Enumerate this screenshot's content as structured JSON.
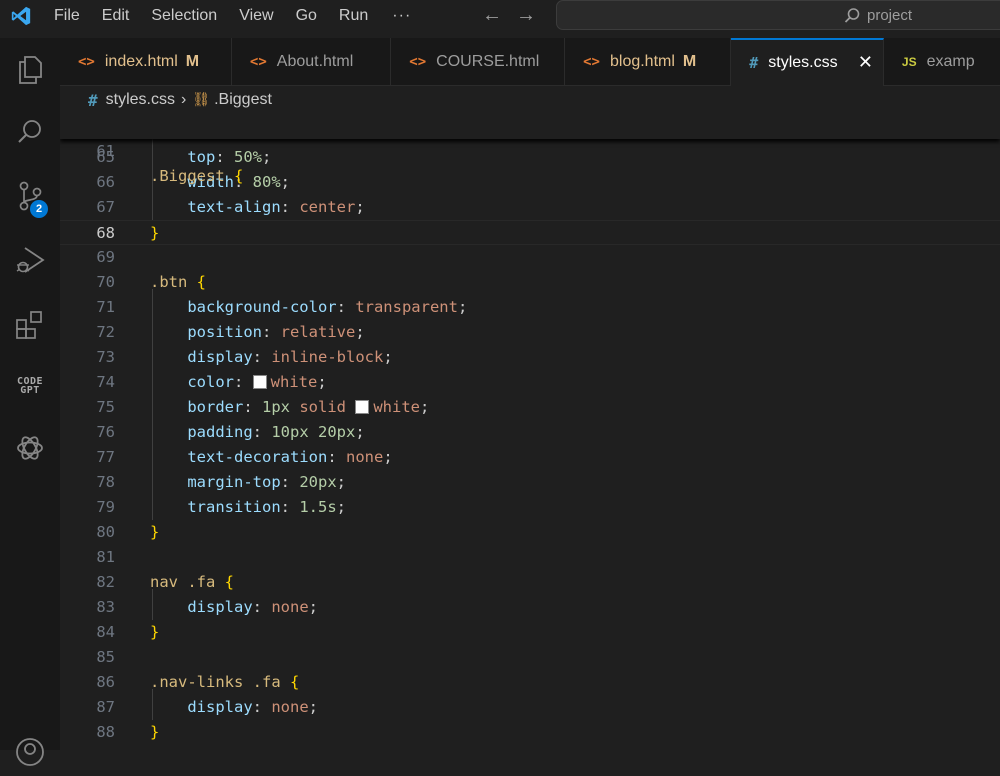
{
  "titlebar": {
    "menu": [
      "File",
      "Edit",
      "Selection",
      "View",
      "Go",
      "Run",
      "···"
    ],
    "search_text": "project"
  },
  "activity": {
    "scm_badge": "2",
    "codegpt_line1": "CODE",
    "codegpt_line2": "GPT"
  },
  "tabs": [
    {
      "name": "index.html",
      "type": "html",
      "modified": "M"
    },
    {
      "name": "About.html",
      "type": "html",
      "modified": ""
    },
    {
      "name": "COURSE.html",
      "type": "html",
      "modified": ""
    },
    {
      "name": "blog.html",
      "type": "html",
      "modified": "M"
    },
    {
      "name": "styles.css",
      "type": "css",
      "modified": "",
      "active": true
    },
    {
      "name": "examp",
      "type": "js",
      "modified": ""
    }
  ],
  "breadcrumb": {
    "file": "styles.css",
    "symbol": ".Biggest"
  },
  "editor": {
    "sticky_line_number": "61",
    "sticky_selector": ".Biggest",
    "current_line": "68",
    "lines": [
      {
        "n": "65",
        "prop": "top",
        "value": "50%"
      },
      {
        "n": "66",
        "prop": "width",
        "value": "80%"
      },
      {
        "n": "67",
        "prop": "text-align",
        "value": "center"
      },
      {
        "n": "68",
        "text": "}"
      },
      {
        "n": "69",
        "text": ""
      },
      {
        "n": "70",
        "selector": ".btn"
      },
      {
        "n": "71",
        "prop": "background-color",
        "value": "transparent"
      },
      {
        "n": "72",
        "prop": "position",
        "value": "relative"
      },
      {
        "n": "73",
        "prop": "display",
        "value": "inline-block"
      },
      {
        "n": "74",
        "prop": "color",
        "value": "white",
        "swatch": "#ffffff"
      },
      {
        "n": "75",
        "prop": "border",
        "value": "1px solid",
        "value2": "white",
        "swatch": "#ffffff"
      },
      {
        "n": "76",
        "prop": "padding",
        "value": "10px 20px"
      },
      {
        "n": "77",
        "prop": "text-decoration",
        "value": "none"
      },
      {
        "n": "78",
        "prop": "margin-top",
        "value": "20px"
      },
      {
        "n": "79",
        "prop": "transition",
        "value": "1.5s"
      },
      {
        "n": "80",
        "text": "}"
      },
      {
        "n": "81",
        "text": ""
      },
      {
        "n": "82",
        "selector": "nav .fa"
      },
      {
        "n": "83",
        "prop": "display",
        "value": "none"
      },
      {
        "n": "84",
        "text": "}"
      },
      {
        "n": "85",
        "text": ""
      },
      {
        "n": "86",
        "selector": ".nav-links .fa"
      },
      {
        "n": "87",
        "prop": "display",
        "value": "none"
      },
      {
        "n": "88",
        "text": "}"
      }
    ]
  },
  "colors": {
    "accent": "#0078d4",
    "selector": "#d7ba7d",
    "property": "#9cdcfe",
    "value": "#ce9178",
    "bracket": "#ffd700"
  }
}
